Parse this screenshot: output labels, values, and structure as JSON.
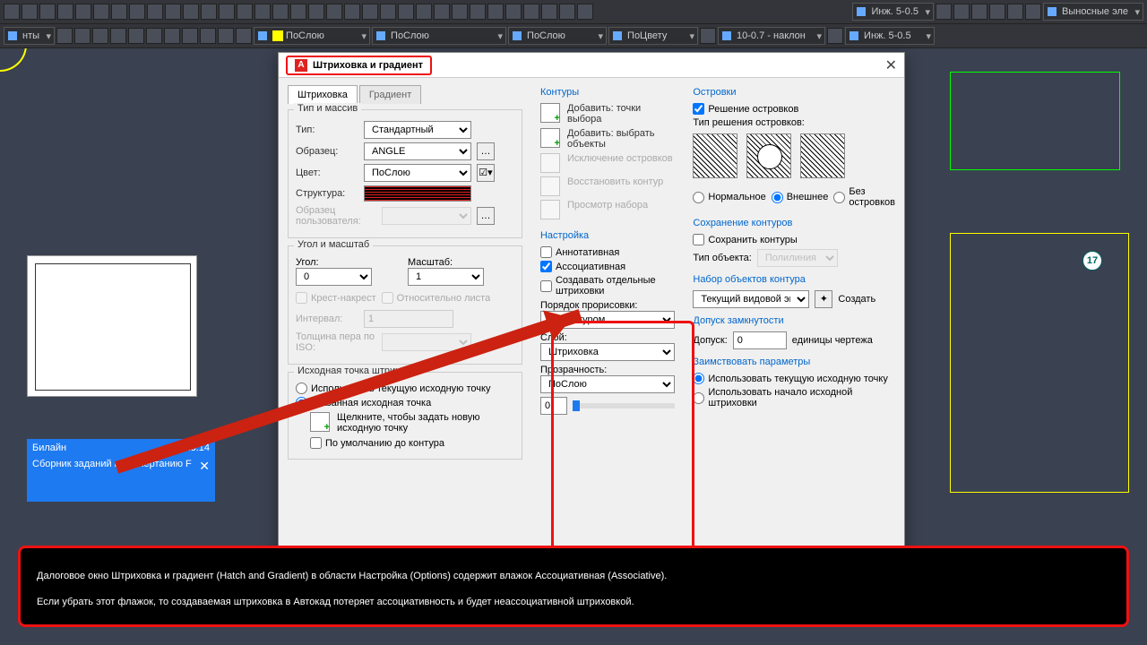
{
  "toolbar": {
    "combos_top": [
      "Инж. 5-0.5",
      "Выносные эле"
    ],
    "combos_bot_left": "нты",
    "bylayer": "ПоСлою",
    "bycolor": "ПоЦвету",
    "dim1": "10-0.7 - наклон",
    "dim2": "Инж. 5-0.5"
  },
  "dialog": {
    "title": "Штриховка и градиент",
    "tabs": {
      "hatch": "Штриховка",
      "grad": "Градиент"
    },
    "type_section": "Тип и массив",
    "type_lbl": "Тип:",
    "type_val": "Стандартный",
    "pattern_lbl": "Образец:",
    "pattern_val": "ANGLE",
    "color_lbl": "Цвет:",
    "color_val": "ПоСлою",
    "struct_lbl": "Структура:",
    "userpat_lbl": "Образец пользователя:",
    "angle_section": "Угол и масштаб",
    "angle_lbl": "Угол:",
    "angle_val": "0",
    "scale_lbl": "Масштаб:",
    "scale_val": "1",
    "cross": "Крест-накрест",
    "relpaper": "Относительно листа",
    "spacing_lbl": "Интервал:",
    "spacing_val": "1",
    "iso_lbl": "Толщина пера по ISO:",
    "origin_section": "Исходная точка штриховки",
    "origin_cur": "Использовать текущую исходную точку",
    "origin_spec": "Указанная исходная точка",
    "origin_click": "Щелкните, чтобы задать новую исходную точку",
    "origin_default": "По умолчанию до контура"
  },
  "boundaries": {
    "h": "Контуры",
    "addpts": "Добавить: точки выбора",
    "addsel": "Добавить: выбрать объекты",
    "remove": "Исключение островков",
    "recreate": "Восстановить контур",
    "view": "Просмотр набора"
  },
  "options": {
    "h": "Настройка",
    "anno": "Аннотативная",
    "assoc": "Ассоциативная",
    "sep": "Создавать отдельные штриховки",
    "draworder_lbl": "Порядок прорисовки:",
    "draworder_val": "За контуром",
    "layer_lbl": "Слой:",
    "layer_val": "Штриховка",
    "trans_lbl": "Прозрачность:",
    "trans_val": "ПоСлою",
    "trans_num": "0"
  },
  "islands": {
    "h": "Островки",
    "detect": "Решение островков",
    "style_lbl": "Тип решения островков:",
    "normal": "Нормальное",
    "outer": "Внешнее",
    "ignore": "Без островков"
  },
  "retain": {
    "h": "Сохранение контуров",
    "keep": "Сохранить контуры",
    "objtype_lbl": "Тип объекта:",
    "objtype_val": "Полилиния"
  },
  "bset": {
    "h": "Набор объектов контура",
    "val": "Текущий видовой экран",
    "new": "Создать"
  },
  "gap": {
    "h": "Допуск замкнутости",
    "lbl": "Допуск:",
    "val": "0",
    "units": "единицы чертежа"
  },
  "inherit": {
    "h": "Заимствовать параметры",
    "cur": "Использовать текущую исходную точку",
    "src": "Использовать начало исходной штриховки"
  },
  "phone": {
    "time": "23:14",
    "carrier": "Билайн",
    "title": "Сборник заданий по начертанию F"
  },
  "badge": "17",
  "caption": "Далоговое окно Штриховка и градиент (Hatch and Gradient) в области Настройка (Options) содержит влажок Ассоциативная (Associative).\nЕсли убрать этот флажок, то создаваемая штриховка в Автокад потеряет ассоциативность и будет неассоциативной штриховкой."
}
